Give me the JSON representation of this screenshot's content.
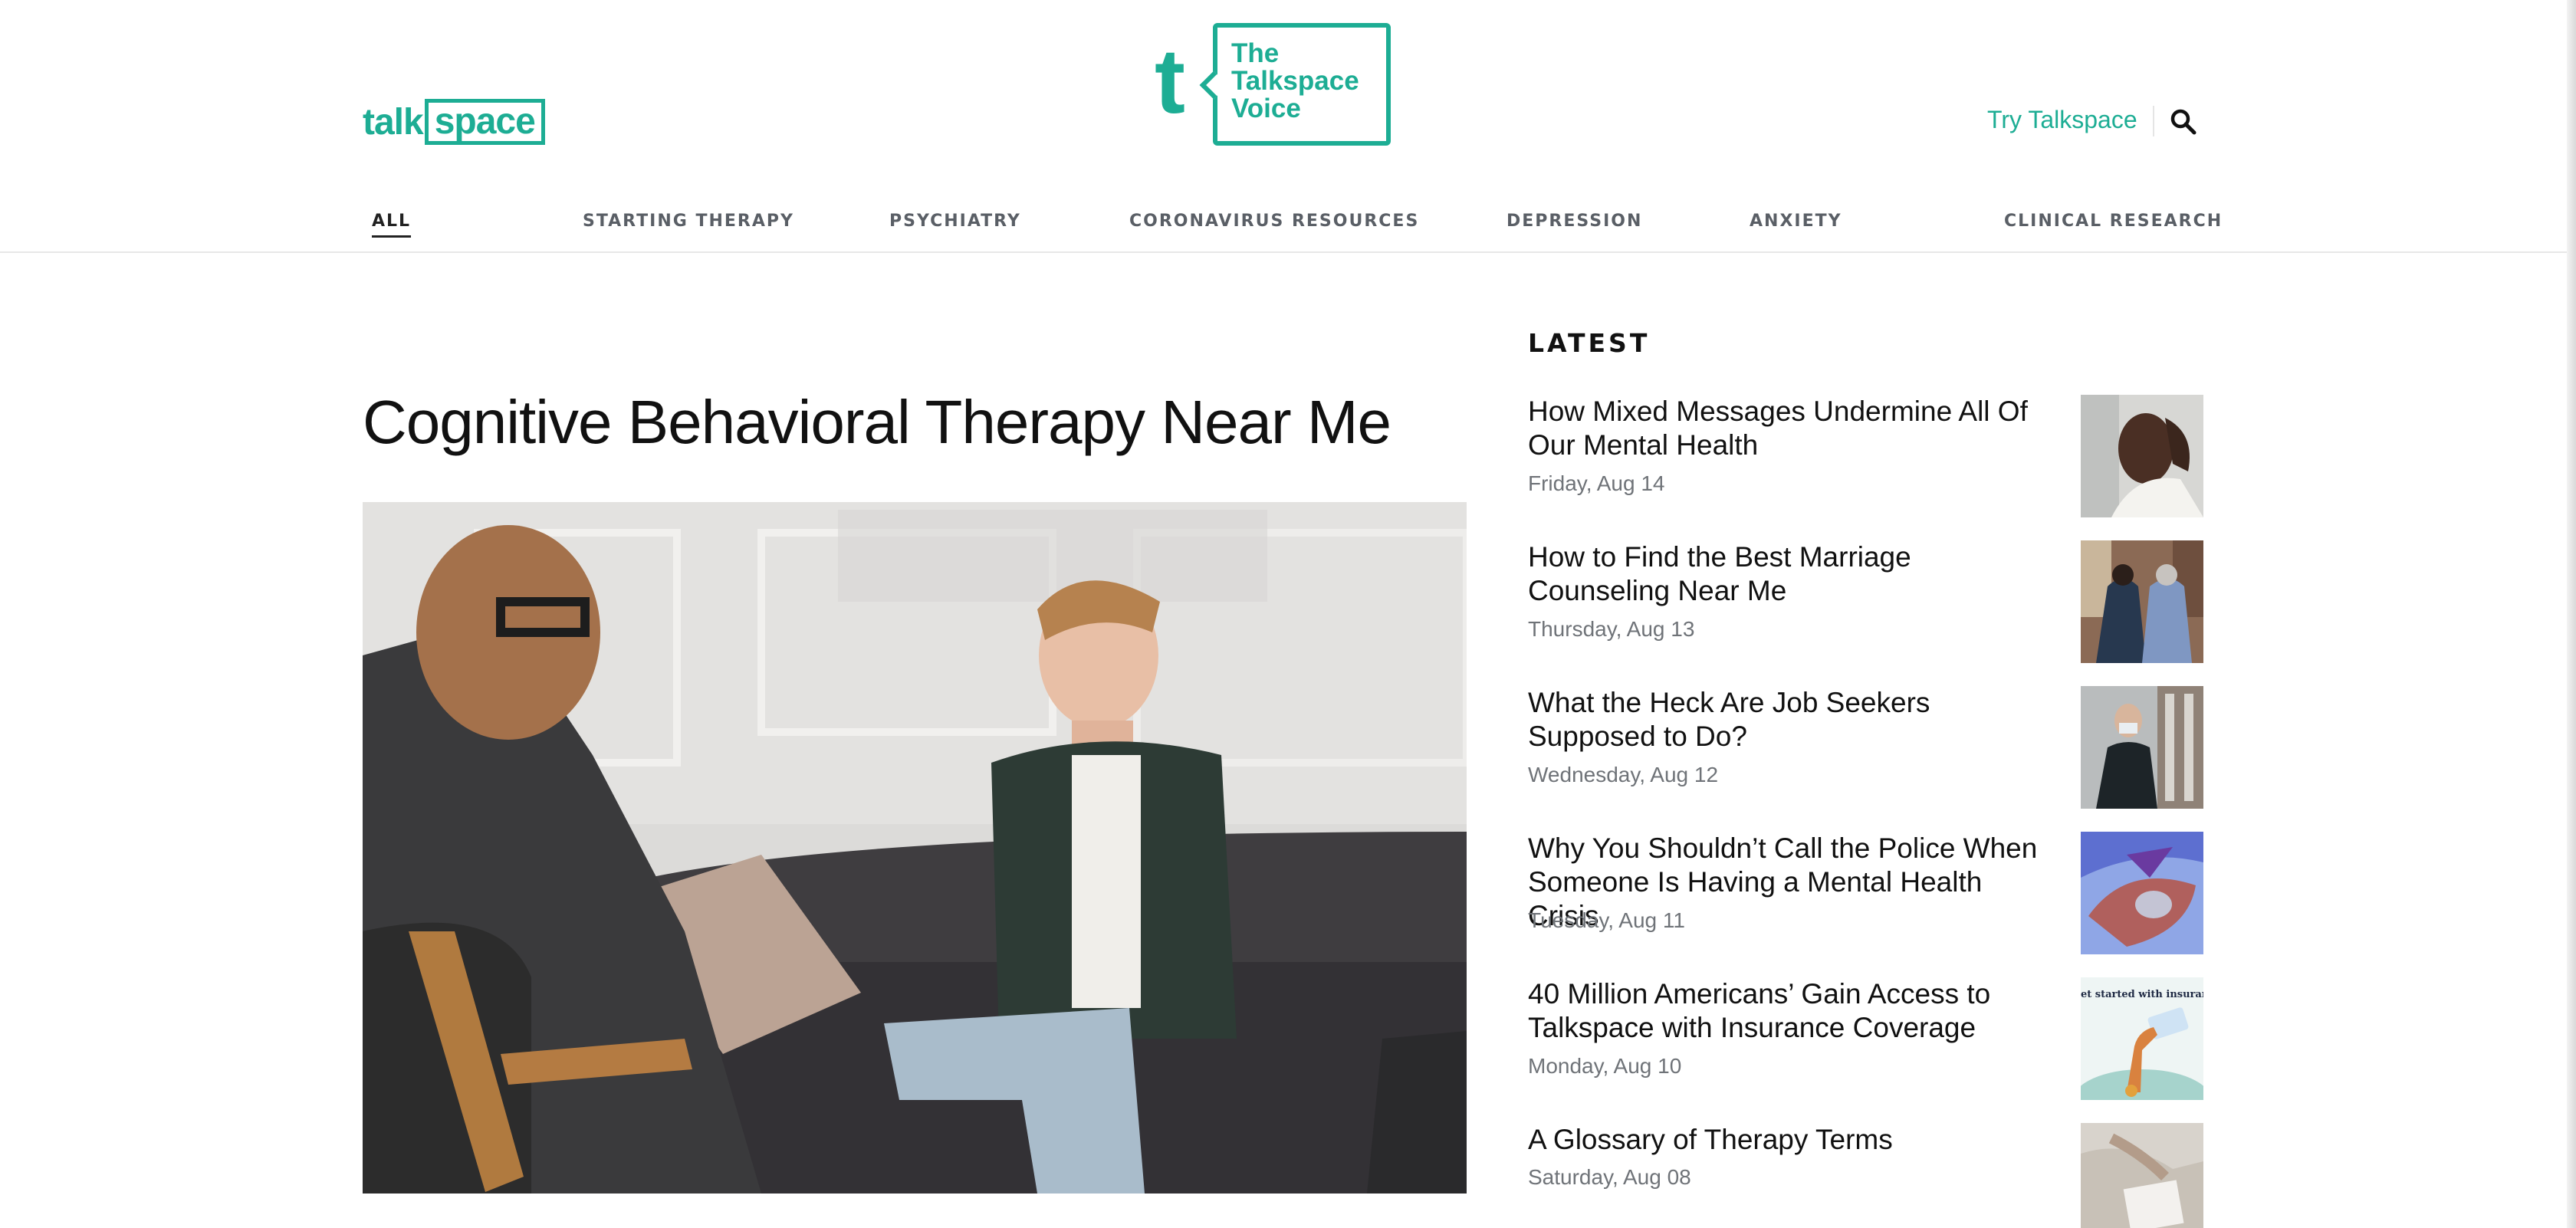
{
  "header": {
    "logo_talk": "talk",
    "logo_space": "space",
    "voice_letter": "t",
    "voice_line1": "The",
    "voice_line2": "Talkspace",
    "voice_line3": "Voice",
    "try_link": "Try Talkspace",
    "search_icon": "search-icon",
    "brand_color": "#1dad94"
  },
  "nav": {
    "items": [
      {
        "label": "ALL",
        "active": true
      },
      {
        "label": "STARTING THERAPY"
      },
      {
        "label": "PSYCHIATRY"
      },
      {
        "label": "CORONAVIRUS RESOURCES"
      },
      {
        "label": "DEPRESSION"
      },
      {
        "label": "ANXIETY"
      },
      {
        "label": "CLINICAL RESEARCH"
      }
    ]
  },
  "main": {
    "title": "Cognitive Behavioral Therapy Near Me"
  },
  "latest": {
    "heading": "LATEST",
    "items": [
      {
        "title": "How Mixed Messages Undermine All Of Our Mental Health",
        "date": "Friday, Aug 14"
      },
      {
        "title": "How to Find the Best Marriage Counseling Near Me",
        "date": "Thursday, Aug 13"
      },
      {
        "title": "What the Heck Are Job Seekers Supposed to Do?",
        "date": "Wednesday, Aug 12"
      },
      {
        "title": "Why You Shouldn’t Call the Police When Someone Is Having a Mental Health Crisis",
        "date": "Tuesday, Aug 11"
      },
      {
        "title": "40 Million Americans’ Gain Access to Talkspace with Insurance Coverage",
        "date": "Monday, Aug 10",
        "thumb_text": "et started with insuranc"
      },
      {
        "title": "A Glossary of Therapy Terms",
        "date": "Saturday, Aug 08"
      }
    ]
  }
}
